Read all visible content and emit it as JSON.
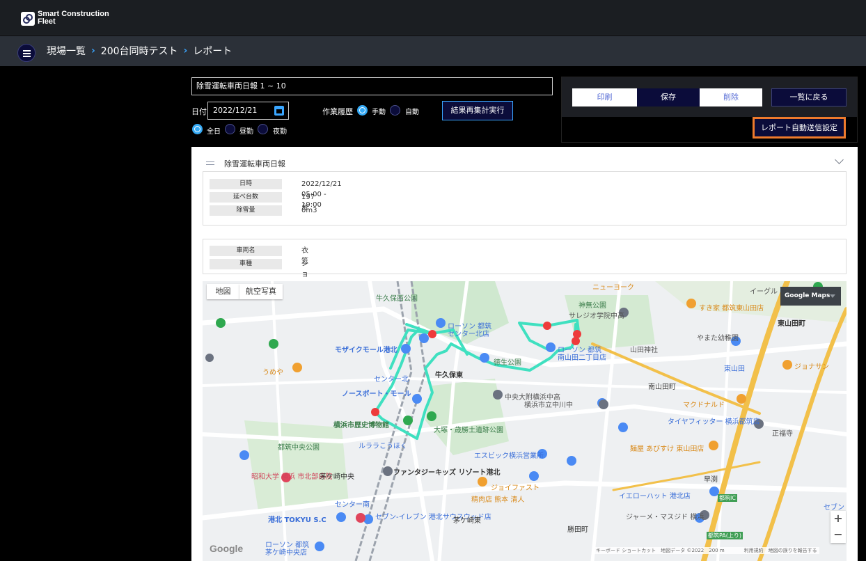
{
  "app": {
    "logo_line1": "Smart Construction",
    "logo_line2": "Fleet"
  },
  "breadcrumb": {
    "items": [
      "現場一覧",
      "200台同時テスト",
      "レポート"
    ]
  },
  "form": {
    "title_value": "除雪運転車両日報 1 ~ 10",
    "date_label": "日付",
    "date_value": "2022/12/21",
    "history_label": "作業履歴",
    "history_options": [
      "手動",
      "自動"
    ],
    "history_selected": "手動",
    "recalc_button": "結果再集計実行",
    "period_options": [
      "全日",
      "昼勤",
      "夜勤"
    ],
    "period_selected": "全日"
  },
  "actions": {
    "print": "印刷",
    "save": "保存",
    "delete": "削除",
    "back": "一覧に戻る",
    "report_auto_send": "レポート自動送信設定"
  },
  "report": {
    "title": "除雪運転車両日報",
    "summary": [
      {
        "key": "日時",
        "value": "2022/12/21 05:00 - 19:00"
      },
      {
        "key": "延べ台数",
        "value": "197台"
      },
      {
        "key": "除雪量",
        "value": "0m3"
      }
    ],
    "vehicle": [
      {
        "key": "車両名",
        "value": "衣笠"
      },
      {
        "key": "車種",
        "value": "ショベル"
      }
    ]
  },
  "map": {
    "tab_map": "地図",
    "tab_satellite": "航空写真",
    "badge": "Google Maps",
    "zoom_in": "+",
    "zoom_out": "−",
    "google_logo": "Google",
    "footer": "キーボード ショートカット　地図データ ©2022　200 m　　　　利用規約　地図の誤りを報告する",
    "route_color": "#3fe0c0",
    "marker_color": "#ee3b3b",
    "labels": [
      "牛久保西公園",
      "神無公園",
      "ローソン 都筑",
      "センター北店",
      "モザイクモール港北",
      "サレジオ学院中高",
      "ローソン 都筑",
      "南山田二丁目店",
      "山田神社",
      "徳生公園",
      "すき家 都筑東山田店",
      "東山田町",
      "やまた幼稚園",
      "東山田",
      "ジョナサン",
      "うめや",
      "牛久保東",
      "センター北",
      "ノースポート・モール",
      "中央大附横浜中高",
      "横浜市立中川中",
      "南山田町",
      "マクドナルド",
      "横浜市歴史博物館",
      "大塚・歳勝土遺跡公園",
      "タイヤフィッター 横浜都筑店",
      "正福寺",
      "都筑中央公園",
      "ルララこうほく",
      "エスビック横浜営業所",
      "麺屋 あびすけ 東山田店",
      "昭和大学 横浜 市北部病院",
      "茅ケ崎中央",
      "ファンタジーキッズ リゾート港北",
      "ジョイファスト",
      "精肉店 熊本 清人",
      "早渕",
      "イエローハット 港北店",
      "センター南",
      "港北 TOKYU S.C",
      "セブン-イレブン 港北サウスウッド店",
      "茅ケ崎東",
      "ジャーメ・マスジド 横浜",
      "勝田町",
      "ローソン 都筑",
      "茅ケ崎中央店",
      "ニューヨーク",
      "イーグル",
      "都筑IC",
      "都筑PA(上り)",
      "セブン"
    ]
  }
}
